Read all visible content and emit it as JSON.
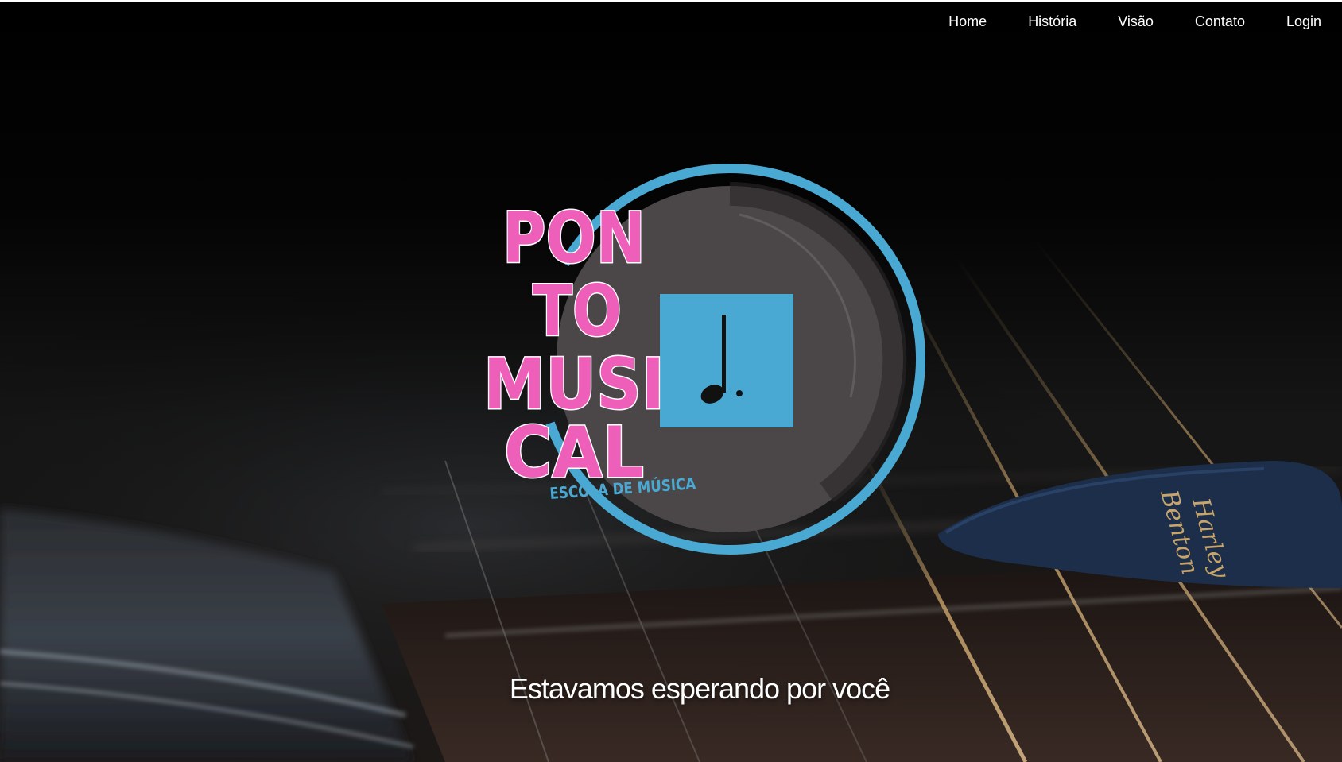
{
  "nav": {
    "items": [
      {
        "label": "Home"
      },
      {
        "label": "História"
      },
      {
        "label": "Visão"
      },
      {
        "label": "Contato"
      },
      {
        "label": "Login"
      }
    ]
  },
  "logo": {
    "lines": [
      "PON",
      "TO",
      "MUSI",
      "CAL"
    ],
    "subtitle": "ESCOLA DE MÚSICA",
    "colors": {
      "pink": "#ee5fb9",
      "blue": "#4aa9d3",
      "disc": "#4b4748"
    }
  },
  "hero": {
    "tagline": "Estavamos esperando por você",
    "pick_text": [
      "Harley",
      "Benton"
    ]
  },
  "colors": {
    "background": "#000000",
    "nav_text": "#ffffff"
  }
}
